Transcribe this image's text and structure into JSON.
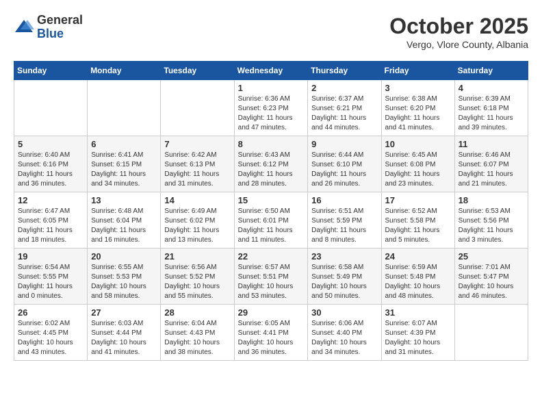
{
  "logo": {
    "general": "General",
    "blue": "Blue"
  },
  "title": {
    "month": "October 2025",
    "location": "Vergo, Vlore County, Albania"
  },
  "days_of_week": [
    "Sunday",
    "Monday",
    "Tuesday",
    "Wednesday",
    "Thursday",
    "Friday",
    "Saturday"
  ],
  "weeks": [
    [
      {
        "day": "",
        "info": ""
      },
      {
        "day": "",
        "info": ""
      },
      {
        "day": "",
        "info": ""
      },
      {
        "day": "1",
        "info": "Sunrise: 6:36 AM\nSunset: 6:23 PM\nDaylight: 11 hours and 47 minutes."
      },
      {
        "day": "2",
        "info": "Sunrise: 6:37 AM\nSunset: 6:21 PM\nDaylight: 11 hours and 44 minutes."
      },
      {
        "day": "3",
        "info": "Sunrise: 6:38 AM\nSunset: 6:20 PM\nDaylight: 11 hours and 41 minutes."
      },
      {
        "day": "4",
        "info": "Sunrise: 6:39 AM\nSunset: 6:18 PM\nDaylight: 11 hours and 39 minutes."
      }
    ],
    [
      {
        "day": "5",
        "info": "Sunrise: 6:40 AM\nSunset: 6:16 PM\nDaylight: 11 hours and 36 minutes."
      },
      {
        "day": "6",
        "info": "Sunrise: 6:41 AM\nSunset: 6:15 PM\nDaylight: 11 hours and 34 minutes."
      },
      {
        "day": "7",
        "info": "Sunrise: 6:42 AM\nSunset: 6:13 PM\nDaylight: 11 hours and 31 minutes."
      },
      {
        "day": "8",
        "info": "Sunrise: 6:43 AM\nSunset: 6:12 PM\nDaylight: 11 hours and 28 minutes."
      },
      {
        "day": "9",
        "info": "Sunrise: 6:44 AM\nSunset: 6:10 PM\nDaylight: 11 hours and 26 minutes."
      },
      {
        "day": "10",
        "info": "Sunrise: 6:45 AM\nSunset: 6:08 PM\nDaylight: 11 hours and 23 minutes."
      },
      {
        "day": "11",
        "info": "Sunrise: 6:46 AM\nSunset: 6:07 PM\nDaylight: 11 hours and 21 minutes."
      }
    ],
    [
      {
        "day": "12",
        "info": "Sunrise: 6:47 AM\nSunset: 6:05 PM\nDaylight: 11 hours and 18 minutes."
      },
      {
        "day": "13",
        "info": "Sunrise: 6:48 AM\nSunset: 6:04 PM\nDaylight: 11 hours and 16 minutes."
      },
      {
        "day": "14",
        "info": "Sunrise: 6:49 AM\nSunset: 6:02 PM\nDaylight: 11 hours and 13 minutes."
      },
      {
        "day": "15",
        "info": "Sunrise: 6:50 AM\nSunset: 6:01 PM\nDaylight: 11 hours and 11 minutes."
      },
      {
        "day": "16",
        "info": "Sunrise: 6:51 AM\nSunset: 5:59 PM\nDaylight: 11 hours and 8 minutes."
      },
      {
        "day": "17",
        "info": "Sunrise: 6:52 AM\nSunset: 5:58 PM\nDaylight: 11 hours and 5 minutes."
      },
      {
        "day": "18",
        "info": "Sunrise: 6:53 AM\nSunset: 5:56 PM\nDaylight: 11 hours and 3 minutes."
      }
    ],
    [
      {
        "day": "19",
        "info": "Sunrise: 6:54 AM\nSunset: 5:55 PM\nDaylight: 11 hours and 0 minutes."
      },
      {
        "day": "20",
        "info": "Sunrise: 6:55 AM\nSunset: 5:53 PM\nDaylight: 10 hours and 58 minutes."
      },
      {
        "day": "21",
        "info": "Sunrise: 6:56 AM\nSunset: 5:52 PM\nDaylight: 10 hours and 55 minutes."
      },
      {
        "day": "22",
        "info": "Sunrise: 6:57 AM\nSunset: 5:51 PM\nDaylight: 10 hours and 53 minutes."
      },
      {
        "day": "23",
        "info": "Sunrise: 6:58 AM\nSunset: 5:49 PM\nDaylight: 10 hours and 50 minutes."
      },
      {
        "day": "24",
        "info": "Sunrise: 6:59 AM\nSunset: 5:48 PM\nDaylight: 10 hours and 48 minutes."
      },
      {
        "day": "25",
        "info": "Sunrise: 7:01 AM\nSunset: 5:47 PM\nDaylight: 10 hours and 46 minutes."
      }
    ],
    [
      {
        "day": "26",
        "info": "Sunrise: 6:02 AM\nSunset: 4:45 PM\nDaylight: 10 hours and 43 minutes."
      },
      {
        "day": "27",
        "info": "Sunrise: 6:03 AM\nSunset: 4:44 PM\nDaylight: 10 hours and 41 minutes."
      },
      {
        "day": "28",
        "info": "Sunrise: 6:04 AM\nSunset: 4:43 PM\nDaylight: 10 hours and 38 minutes."
      },
      {
        "day": "29",
        "info": "Sunrise: 6:05 AM\nSunset: 4:41 PM\nDaylight: 10 hours and 36 minutes."
      },
      {
        "day": "30",
        "info": "Sunrise: 6:06 AM\nSunset: 4:40 PM\nDaylight: 10 hours and 34 minutes."
      },
      {
        "day": "31",
        "info": "Sunrise: 6:07 AM\nSunset: 4:39 PM\nDaylight: 10 hours and 31 minutes."
      },
      {
        "day": "",
        "info": ""
      }
    ]
  ]
}
